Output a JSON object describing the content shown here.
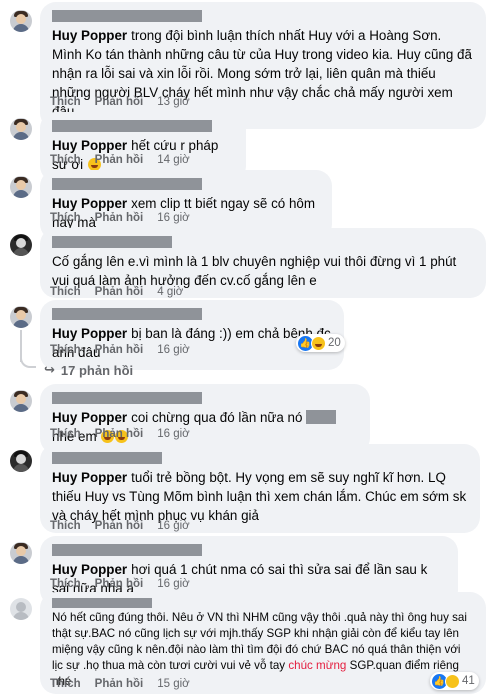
{
  "comments": [
    {
      "author": "Huy Popper",
      "text": "trong đội bình luận thích nhất Huy với a Hoàng Sơn. Mình Ko tán thành những câu từ của Huy trong video kia. Huy cũng đã nhận ra lỗi sai và xin lỗi rồi. Mong sớm trở lại, liên quân mà thiếu những người BLV cháy hết mình như vậy chắc chả mấy người xem đâu",
      "like": "Thích",
      "reply": "Phản hồi",
      "time": "13 giờ"
    },
    {
      "author": "Huy Popper",
      "text": "hết cứu r pháp sư ơi",
      "like": "Thích",
      "reply": "Phản hồi",
      "time": "14 giờ"
    },
    {
      "author": "Huy Popper",
      "text": "xem clip tt biết ngay sẽ có hôm nay mà",
      "like": "Thích",
      "reply": "Phản hồi",
      "time": "16 giờ"
    },
    {
      "author": "",
      "text": "Cố gắng lên e.vì mình là 1 blv chuyên nghiệp vui thôi đừng vì 1 phút vui quá làm ảnh hưởng đến cv.cố gắng lên e",
      "like": "Thích",
      "reply": "Phản hồi",
      "time": "4 giờ"
    },
    {
      "author": "Huy Popper",
      "text": "bị ban là đáng :)) em chả bênh đc anh đâu",
      "like": "Thích",
      "reply": "Phản hồi",
      "time": "16 giờ",
      "reaction_count": "20",
      "replies_label": "17 phản hồi"
    },
    {
      "author": "Huy Popper",
      "text_before": "coi chừng qua đó lần nữa nó",
      "text_after": "nhé em",
      "like": "Thích",
      "reply": "Phản hồi",
      "time": "16 giờ"
    },
    {
      "author": "Huy Popper",
      "text": "tuổi trẻ bồng bột. Hy vọng em sẽ suy nghĩ kĩ hơn. LQ thiếu Huy vs Tùng Mõm bình luận thì xem chán lắm. Chúc em sớm sk và cháy hết mình phục vụ khán giả",
      "like": "Thích",
      "reply": "Phản hồi",
      "time": "16 giờ"
    },
    {
      "author": "Huy Popper",
      "text": "hơi quá 1 chút nma có sai thì sửa sai để lần sau k sai nữa nha a",
      "like": "Thích",
      "reply": "Phản hồi",
      "time": "16 giờ"
    },
    {
      "author": "",
      "text_before": "Nó hết cũng đúng thôi. Nêu ở VN thì NHM cũng vậy thôi .quả này thì ông huy sai thật sự.BAC nó cũng lịch sự với mjh.thấy SGP khi nhận giải còn để kiểu tay lên miệng vậy cũng k nên.đội nào làm thì tìm đội đó chứ BAC nó quá thân thiện với lịc sự .họ thua mà còn tươi cười vui vẻ vỗ tay",
      "highlight": "chúc mừng",
      "text_after": "SGP.quan điểm riêng nhé",
      "like": "Thích",
      "reply": "Phản hồi",
      "time": "15 giờ",
      "reaction_count": "41"
    }
  ],
  "icons": {
    "reply_arrow": "reply-arrow-icon",
    "like_reaction": "like-reaction-icon",
    "haha_reaction": "haha-reaction-icon"
  },
  "colors": {
    "bubble": "#f0f2f5",
    "meta_text": "#65676b",
    "like_blue": "#1877f2",
    "highlight_red": "#e41e3f"
  }
}
